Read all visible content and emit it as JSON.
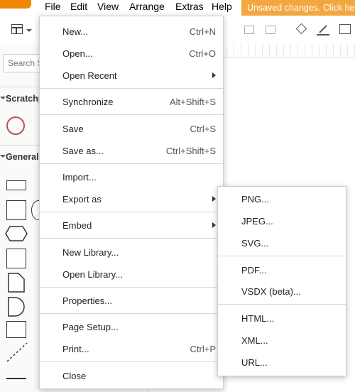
{
  "menubar": {
    "items": [
      "File",
      "Edit",
      "View",
      "Arrange",
      "Extras",
      "Help"
    ],
    "unsaved_text": "Unsaved changes. Click here"
  },
  "sidebar": {
    "search_placeholder": "Search Shapes",
    "scratchpad_title": "Scratchpad",
    "general_title": "General"
  },
  "file_menu": {
    "new": {
      "label": "New...",
      "shortcut": "Ctrl+N"
    },
    "open": {
      "label": "Open...",
      "shortcut": "Ctrl+O"
    },
    "open_recent": {
      "label": "Open Recent"
    },
    "synchronize": {
      "label": "Synchronize",
      "shortcut": "Alt+Shift+S"
    },
    "save": {
      "label": "Save",
      "shortcut": "Ctrl+S"
    },
    "save_as": {
      "label": "Save as...",
      "shortcut": "Ctrl+Shift+S"
    },
    "import": {
      "label": "Import..."
    },
    "export_as": {
      "label": "Export as"
    },
    "embed": {
      "label": "Embed"
    },
    "new_library": {
      "label": "New Library..."
    },
    "open_library": {
      "label": "Open Library..."
    },
    "properties": {
      "label": "Properties..."
    },
    "page_setup": {
      "label": "Page Setup..."
    },
    "print": {
      "label": "Print...",
      "shortcut": "Ctrl+P"
    },
    "close": {
      "label": "Close"
    }
  },
  "export_submenu": {
    "png": "PNG...",
    "jpeg": "JPEG...",
    "svg": "SVG...",
    "pdf": "PDF...",
    "vsdx": "VSDX (beta)...",
    "html": "HTML...",
    "xml": "XML...",
    "url": "URL..."
  },
  "colors": {
    "brand": "#f08705",
    "unsaved_bg": "#f4a640"
  }
}
